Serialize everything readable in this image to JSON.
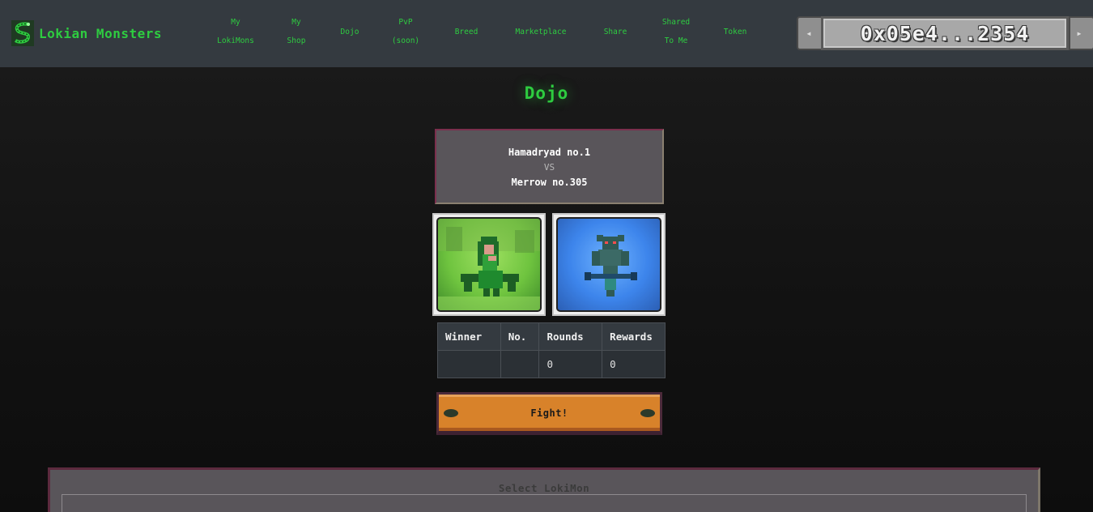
{
  "header": {
    "brand": "Lokian Monsters",
    "nav": [
      {
        "line1": "My",
        "line2": "LokiMons"
      },
      {
        "line1": "My",
        "line2": "Shop"
      },
      {
        "line1": "Dojo",
        "line2": ""
      },
      {
        "line1": "PvP",
        "line2": "(soon)"
      },
      {
        "line1": "Breed",
        "line2": ""
      },
      {
        "line1": "Marketplace",
        "line2": ""
      },
      {
        "line1": "Share",
        "line2": ""
      },
      {
        "line1": "Shared",
        "line2": "To Me"
      },
      {
        "line1": "Token",
        "line2": ""
      }
    ],
    "wallet": "0x05e4...2354"
  },
  "page": {
    "title": "Dojo"
  },
  "matchup": {
    "fighter1": "Hamadryad no.1",
    "vs": "VS",
    "fighter2": "Merrow no.305"
  },
  "cards": {
    "left_icon": "hamadryad-sprite",
    "right_icon": "merrow-sprite"
  },
  "results": {
    "headers": [
      "Winner",
      "No.",
      "Rounds",
      "Rewards"
    ],
    "row": [
      "",
      "",
      "0",
      "0"
    ]
  },
  "fight": {
    "label": "Fight!"
  },
  "select": {
    "title": "Select LokiMon"
  },
  "colors": {
    "accent": "#2ecc40",
    "header_bg": "#343a40",
    "button": "#d8822a",
    "panel": "#59555a"
  }
}
